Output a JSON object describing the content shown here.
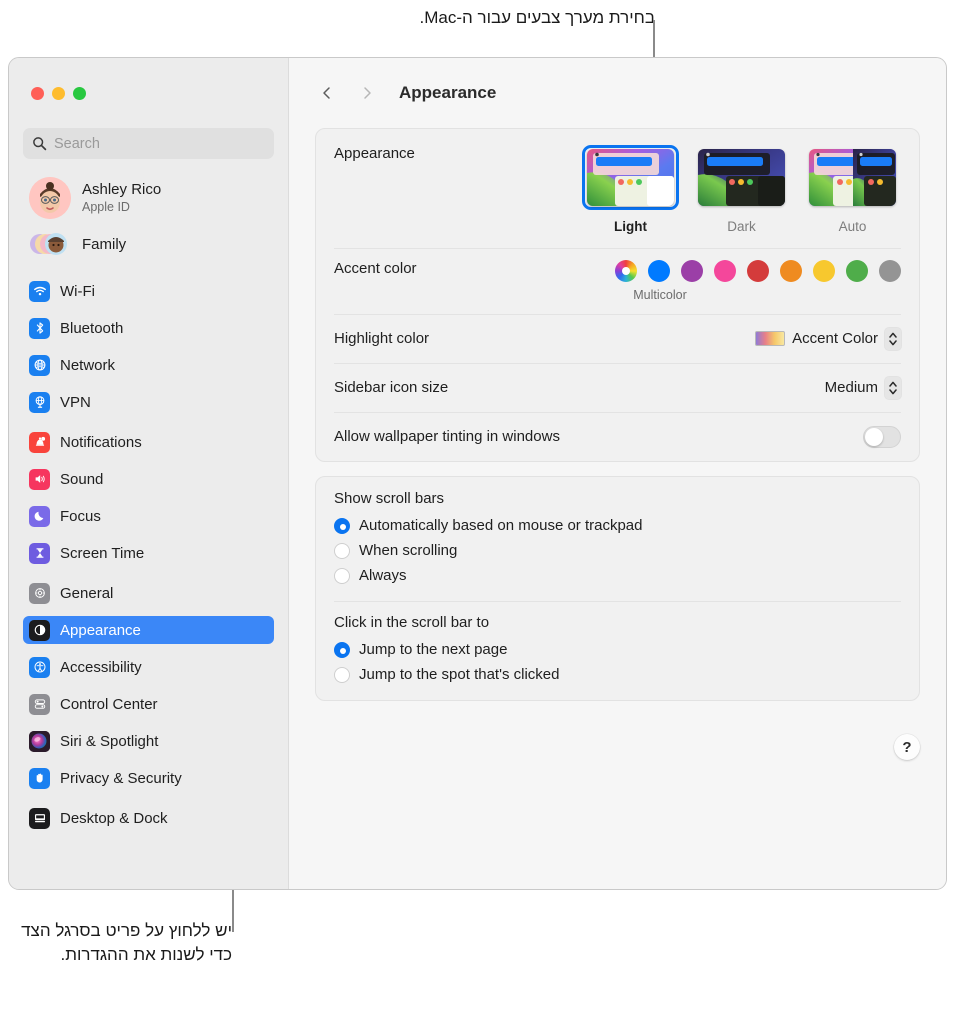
{
  "callouts": {
    "top": "בחירת מערך צבעים עבור ה-Mac.",
    "bottom": "יש ללחוץ על פריט בסרגל הצד כדי לשנות את ההגדרות."
  },
  "window": {
    "traffic_lights": [
      {
        "name": "close",
        "color": "#ff5f57"
      },
      {
        "name": "minimize",
        "color": "#febc2e"
      },
      {
        "name": "zoom",
        "color": "#28c840"
      }
    ]
  },
  "sidebar": {
    "search": {
      "placeholder": "Search",
      "value": ""
    },
    "account": {
      "name": "Ashley Rico",
      "subtitle": "Apple ID"
    },
    "family": {
      "label": "Family"
    },
    "groups": [
      {
        "items": [
          {
            "label": "Wi-Fi",
            "icon": "wifi-icon",
            "color": "#1a80f0",
            "selected": false
          },
          {
            "label": "Bluetooth",
            "icon": "bluetooth-icon",
            "color": "#1a80f0",
            "selected": false
          },
          {
            "label": "Network",
            "icon": "globe-icon",
            "color": "#1a80f0",
            "selected": false
          },
          {
            "label": "VPN",
            "icon": "vpn-globe-icon",
            "color": "#1a80f0",
            "selected": false
          }
        ]
      },
      {
        "items": [
          {
            "label": "Notifications",
            "icon": "bell-icon",
            "color": "#f9443c",
            "selected": false
          },
          {
            "label": "Sound",
            "icon": "speaker-icon",
            "color": "#f6365f",
            "selected": false
          },
          {
            "label": "Focus",
            "icon": "moon-icon",
            "color": "#7a6ae8",
            "selected": false
          },
          {
            "label": "Screen Time",
            "icon": "hourglass-icon",
            "color": "#6e5ce0",
            "selected": false
          }
        ]
      },
      {
        "items": [
          {
            "label": "General",
            "icon": "gear-icon",
            "color": "#8e8e93",
            "selected": false
          },
          {
            "label": "Appearance",
            "icon": "appearance-contrast-icon",
            "color": "#1c1c1e",
            "selected": true
          },
          {
            "label": "Accessibility",
            "icon": "accessibility-icon",
            "color": "#1a80f0",
            "selected": false
          },
          {
            "label": "Control Center",
            "icon": "control-center-icon",
            "color": "#8e8e93",
            "selected": false
          },
          {
            "label": "Siri & Spotlight",
            "icon": "siri-icon",
            "color": "#2b1b2b",
            "selected": false
          },
          {
            "label": "Privacy & Security",
            "icon": "hand-icon",
            "color": "#1a80f0",
            "selected": false
          }
        ]
      },
      {
        "items": [
          {
            "label": "Desktop & Dock",
            "icon": "desktop-dock-icon",
            "color": "#1c1c1e",
            "selected": false
          }
        ]
      }
    ]
  },
  "toolbar": {
    "back_icon": "chevron-left-icon",
    "forward_icon": "chevron-right-icon",
    "title": "Appearance"
  },
  "main": {
    "appearance": {
      "label": "Appearance",
      "themes": [
        {
          "name": "Light",
          "selected": true
        },
        {
          "name": "Dark",
          "selected": false
        },
        {
          "name": "Auto",
          "selected": false
        }
      ]
    },
    "accent_color": {
      "label": "Accent color",
      "caption": "Multicolor",
      "swatches": [
        {
          "name": "Multicolor",
          "color": "multicolor",
          "selected": true
        },
        {
          "name": "Blue",
          "color": "#007aff"
        },
        {
          "name": "Purple",
          "color": "#9b3fa7"
        },
        {
          "name": "Pink",
          "color": "#f4479b"
        },
        {
          "name": "Red",
          "color": "#d43b3b"
        },
        {
          "name": "Orange",
          "color": "#ef8b20"
        },
        {
          "name": "Yellow",
          "color": "#f7c82e"
        },
        {
          "name": "Green",
          "color": "#4fad4a"
        },
        {
          "name": "Graphite",
          "color": "#949494"
        }
      ]
    },
    "highlight_color": {
      "label": "Highlight color",
      "value": "Accent Color"
    },
    "sidebar_icon_size": {
      "label": "Sidebar icon size",
      "value": "Medium"
    },
    "wallpaper_tinting": {
      "label": "Allow wallpaper tinting in windows",
      "on": false
    },
    "scroll_bars": {
      "title": "Show scroll bars",
      "options": [
        {
          "label": "Automatically based on mouse or trackpad",
          "selected": true
        },
        {
          "label": "When scrolling",
          "selected": false
        },
        {
          "label": "Always",
          "selected": false
        }
      ]
    },
    "scroll_click": {
      "title": "Click in the scroll bar to",
      "options": [
        {
          "label": "Jump to the next page",
          "selected": true
        },
        {
          "label": "Jump to the spot that's clicked",
          "selected": false
        }
      ]
    },
    "help": {
      "label": "?"
    }
  }
}
